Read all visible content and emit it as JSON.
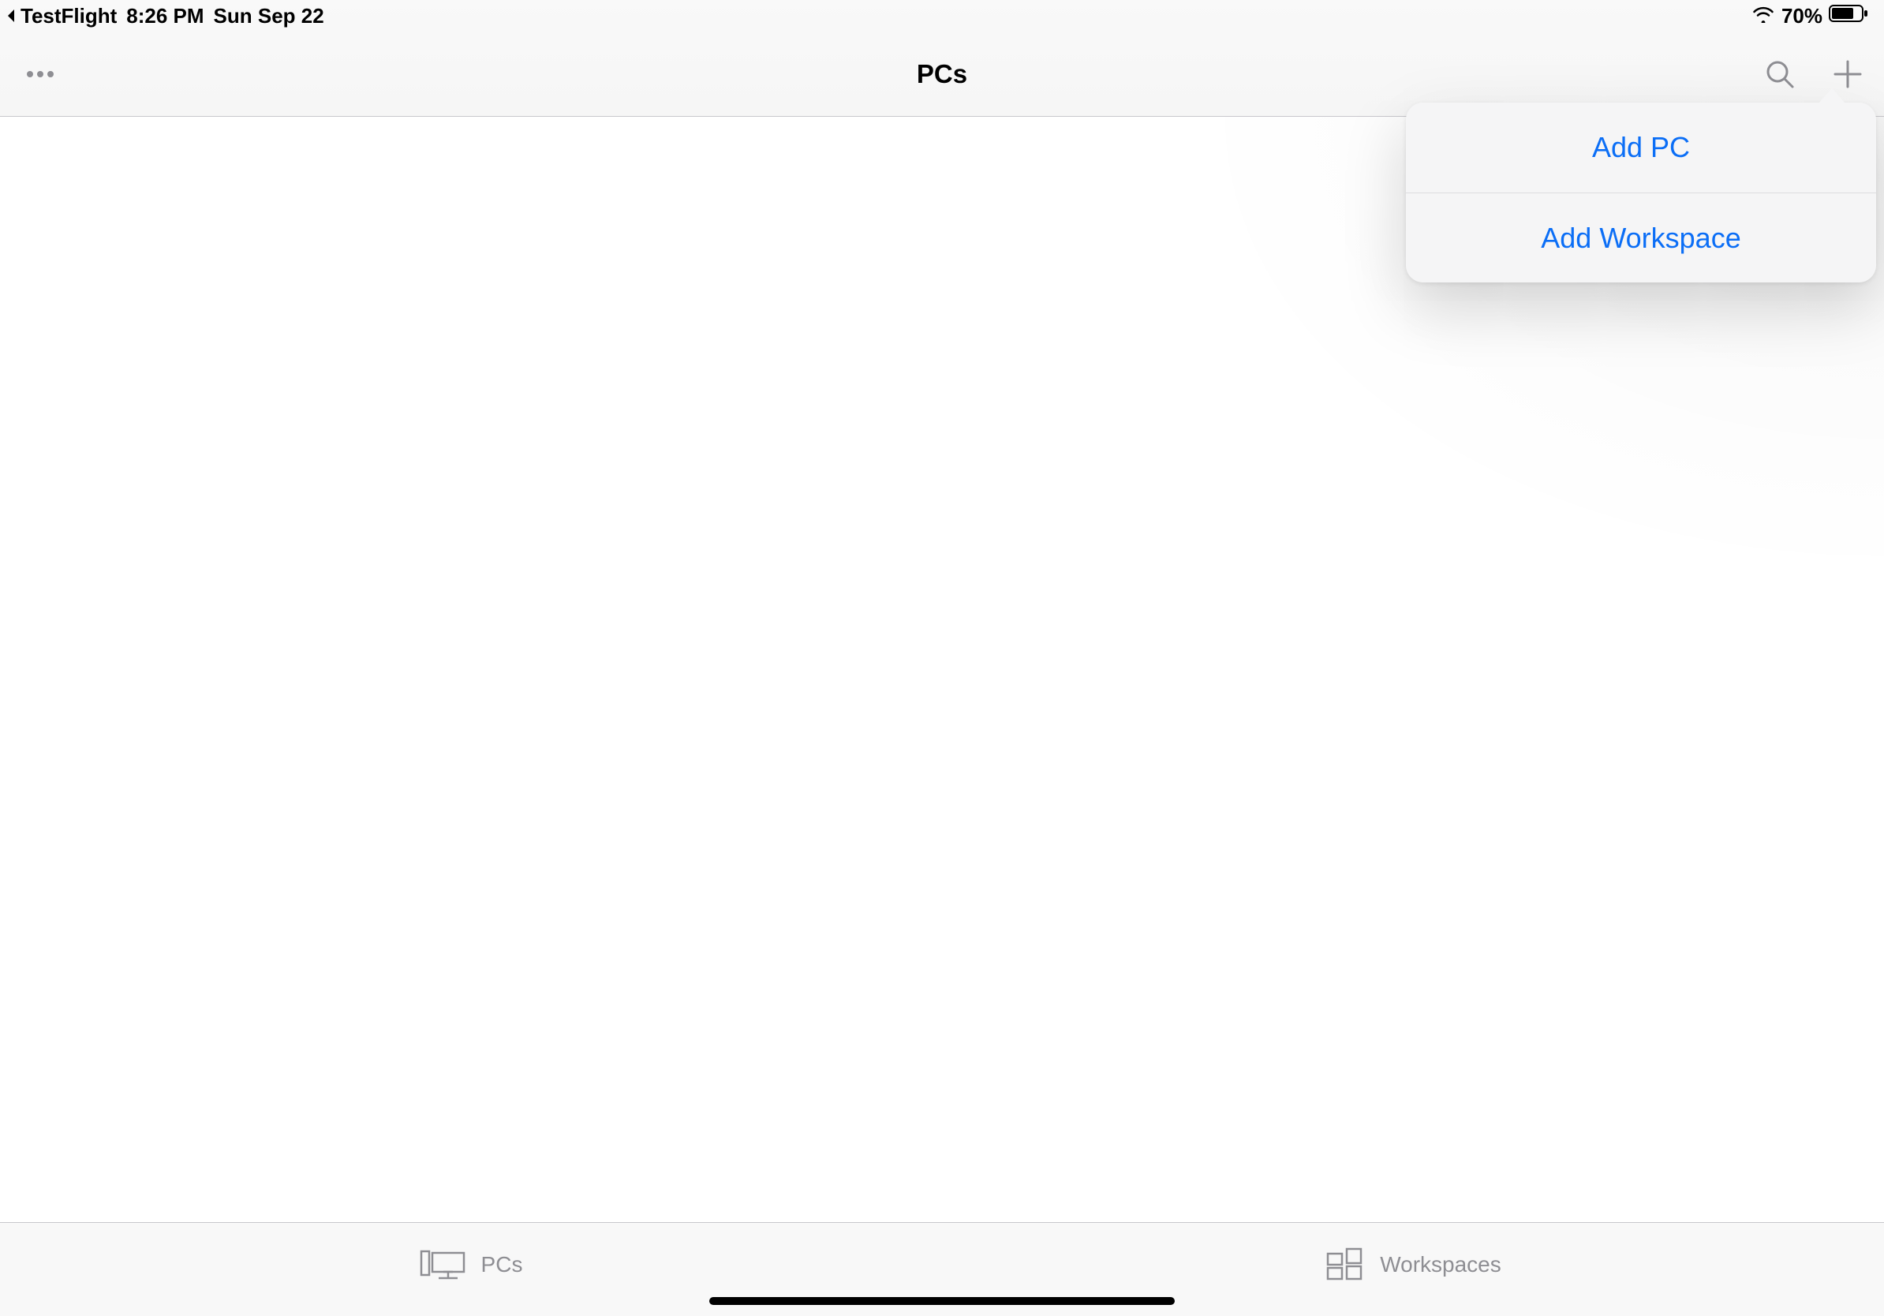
{
  "status_bar": {
    "back_app": "TestFlight",
    "time": "8:26 PM",
    "date": "Sun Sep 22",
    "battery_pct": "70%"
  },
  "nav": {
    "title": "PCs"
  },
  "popover": {
    "items": [
      {
        "label": "Add PC"
      },
      {
        "label": "Add Workspace"
      }
    ]
  },
  "tabs": {
    "pcs": "PCs",
    "workspaces": "Workspaces"
  }
}
